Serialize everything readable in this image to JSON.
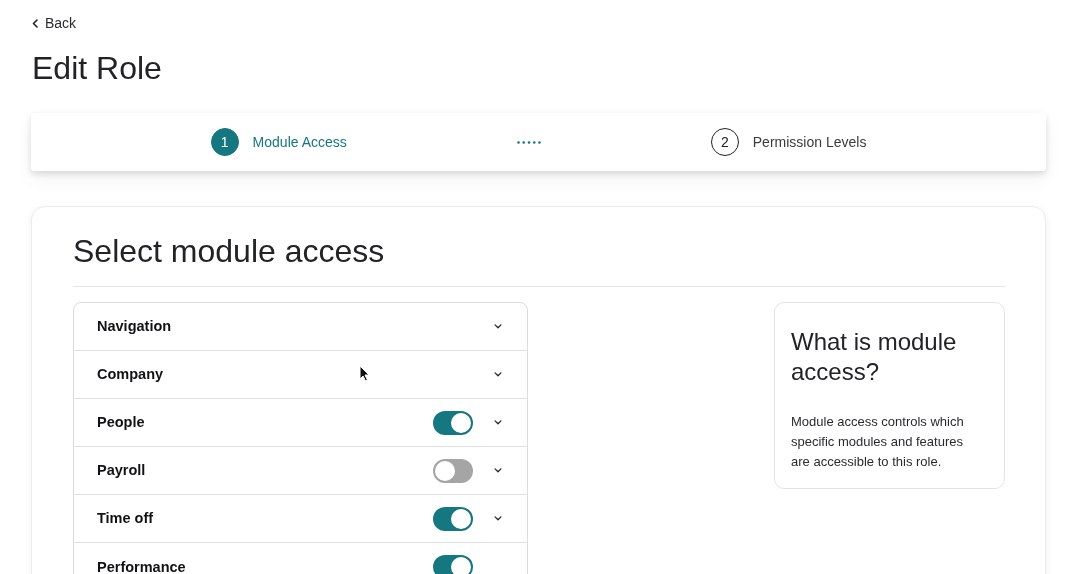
{
  "back_link": {
    "label": "Back"
  },
  "page_title": "Edit Role",
  "stepper": {
    "steps": [
      {
        "number": "1",
        "label": "Module Access",
        "selected": true
      },
      {
        "number": "2",
        "label": "Permission Levels",
        "selected": false
      }
    ]
  },
  "card": {
    "title": "Select module access",
    "modules": [
      {
        "name": "Navigation",
        "kind": "plain",
        "expanded": false
      },
      {
        "name": "Company",
        "kind": "plain",
        "expanded": false
      },
      {
        "name": "People",
        "kind": "toggle",
        "on": true,
        "expanded": false
      },
      {
        "name": "Payroll",
        "kind": "toggle",
        "on": false,
        "expanded": false
      },
      {
        "name": "Time off",
        "kind": "toggle",
        "on": true,
        "expanded": false
      },
      {
        "name": "Performance",
        "kind": "toggle",
        "on": true
      }
    ],
    "info": {
      "title": "What is module access?",
      "body": "Module access controls which specific modules and features are accessible to this role."
    }
  }
}
